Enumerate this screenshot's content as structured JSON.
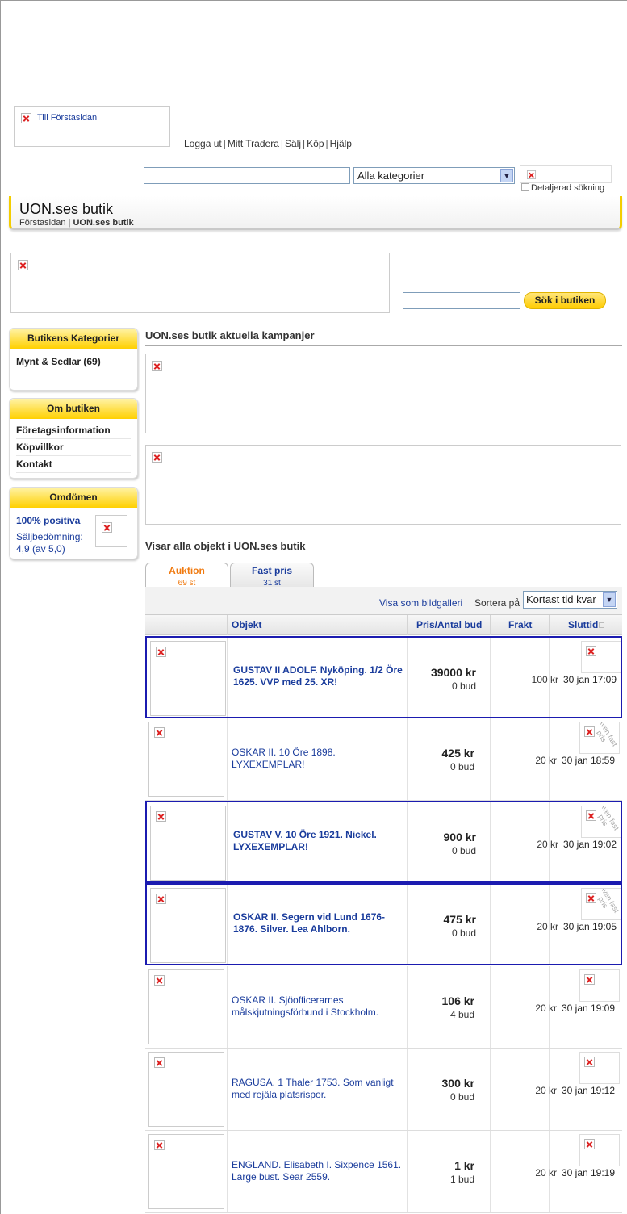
{
  "header": {
    "logo_link": "Till Förstasidan",
    "nav": [
      "Logga ut",
      "Mitt Tradera",
      "Sälj",
      "Köp",
      "Hjälp"
    ],
    "search_value": "",
    "category_selected": "Alla kategorier",
    "detailed_search": "Detaljerad sökning"
  },
  "shop": {
    "title": "UON.ses butik",
    "breadcrumb_home": "Förstasidan",
    "breadcrumb_current": "UON.ses butik",
    "search_button": "Sök i butiken"
  },
  "sidebar": {
    "categories_title": "Butikens Kategorier",
    "categories": [
      "Mynt & Sedlar (69)"
    ],
    "about_title": "Om butiken",
    "about_items": [
      "Företagsinformation",
      "Köpvillkor",
      "Kontakt"
    ],
    "reviews_title": "Omdömen",
    "positive": "100% positiva",
    "rating_label": "Säljbedömning:",
    "rating_value": "4,9 (av 5,0)"
  },
  "main": {
    "campaigns_title": "UON.ses butik aktuella kampanjer",
    "listing_title": "Visar alla objekt i UON.ses butik",
    "tabs": [
      {
        "label": "Auktion",
        "count": "69 st"
      },
      {
        "label": "Fast pris",
        "count": "31 st"
      }
    ],
    "gallery_link": "Visa som bildgalleri",
    "sort_label": "Sortera på",
    "sort_selected": "Kortast tid kvar",
    "columns": [
      "Objekt",
      "Pris/Antal bud",
      "Frakt",
      "Sluttid"
    ],
    "fixed_price_badge": "Även fast pris",
    "rows": [
      {
        "title": "GUSTAV II ADOLF. Nyköping. 1/2 Öre 1625. VVP med 25. XR!",
        "price": "39000 kr",
        "bids": "0 bud",
        "shipping": "100 kr",
        "end": "30 jan 17:09",
        "highlight": true,
        "fixed": false
      },
      {
        "title": "OSKAR II. 10 Öre 1898. LYXEXEMPLAR!",
        "price": "425 kr",
        "bids": "0 bud",
        "shipping": "20 kr",
        "end": "30 jan 18:59",
        "highlight": false,
        "fixed": true
      },
      {
        "title": "GUSTAV V. 10 Öre 1921. Nickel. LYXEXEMPLAR!",
        "price": "900 kr",
        "bids": "0 bud",
        "shipping": "20 kr",
        "end": "30 jan 19:02",
        "highlight": true,
        "fixed": true
      },
      {
        "title": "OSKAR II. Segern vid Lund 1676-1876. Silver. Lea Ahlborn.",
        "price": "475 kr",
        "bids": "0 bud",
        "shipping": "20 kr",
        "end": "30 jan 19:05",
        "highlight": true,
        "fixed": true
      },
      {
        "title": "OSKAR II. Sjöofficerarnes målskjutningsförbund i Stockholm.",
        "price": "106 kr",
        "bids": "4 bud",
        "shipping": "20 kr",
        "end": "30 jan 19:09",
        "highlight": false,
        "fixed": false
      },
      {
        "title": "RAGUSA. 1 Thaler 1753. Som vanligt med rejäla platsrispor.",
        "price": "300 kr",
        "bids": "0 bud",
        "shipping": "20 kr",
        "end": "30 jan 19:12",
        "highlight": false,
        "fixed": false
      },
      {
        "title": "ENGLAND. Elisabeth I. Sixpence 1561. Large bust. Sear 2559.",
        "price": "1 kr",
        "bids": "1 bud",
        "shipping": "20 kr",
        "end": "30 jan 19:19",
        "highlight": false,
        "fixed": false
      }
    ]
  }
}
